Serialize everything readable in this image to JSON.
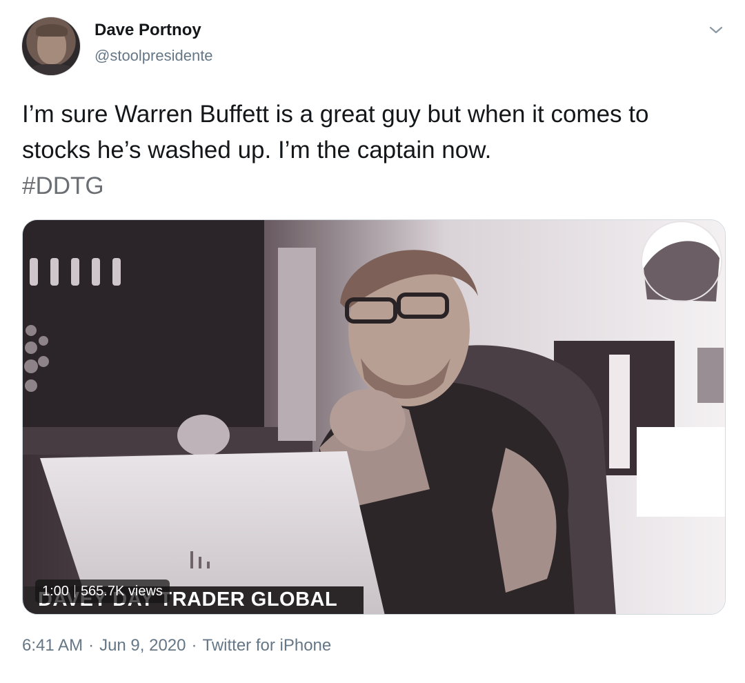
{
  "author": {
    "name": "Dave Portnoy",
    "handle": "@stoolpresidente"
  },
  "icons": {
    "menu": "chevron-down-icon"
  },
  "tweet": {
    "text": "I’m sure Warren Buffett is a great guy but when it comes to stocks he’s washed up. I’m the captain now.",
    "hashtag": "#DDTG"
  },
  "video": {
    "duration": "1:00",
    "views": "565.7K views",
    "banner": "DAVEY DAY TRADER GLOBAL"
  },
  "meta": {
    "time": "6:41 AM",
    "date": "Jun 9, 2020",
    "source": "Twitter for iPhone",
    "separator": "·"
  },
  "colors": {
    "text": "#14171a",
    "secondary": "#657786",
    "border": "#cfd9de"
  }
}
